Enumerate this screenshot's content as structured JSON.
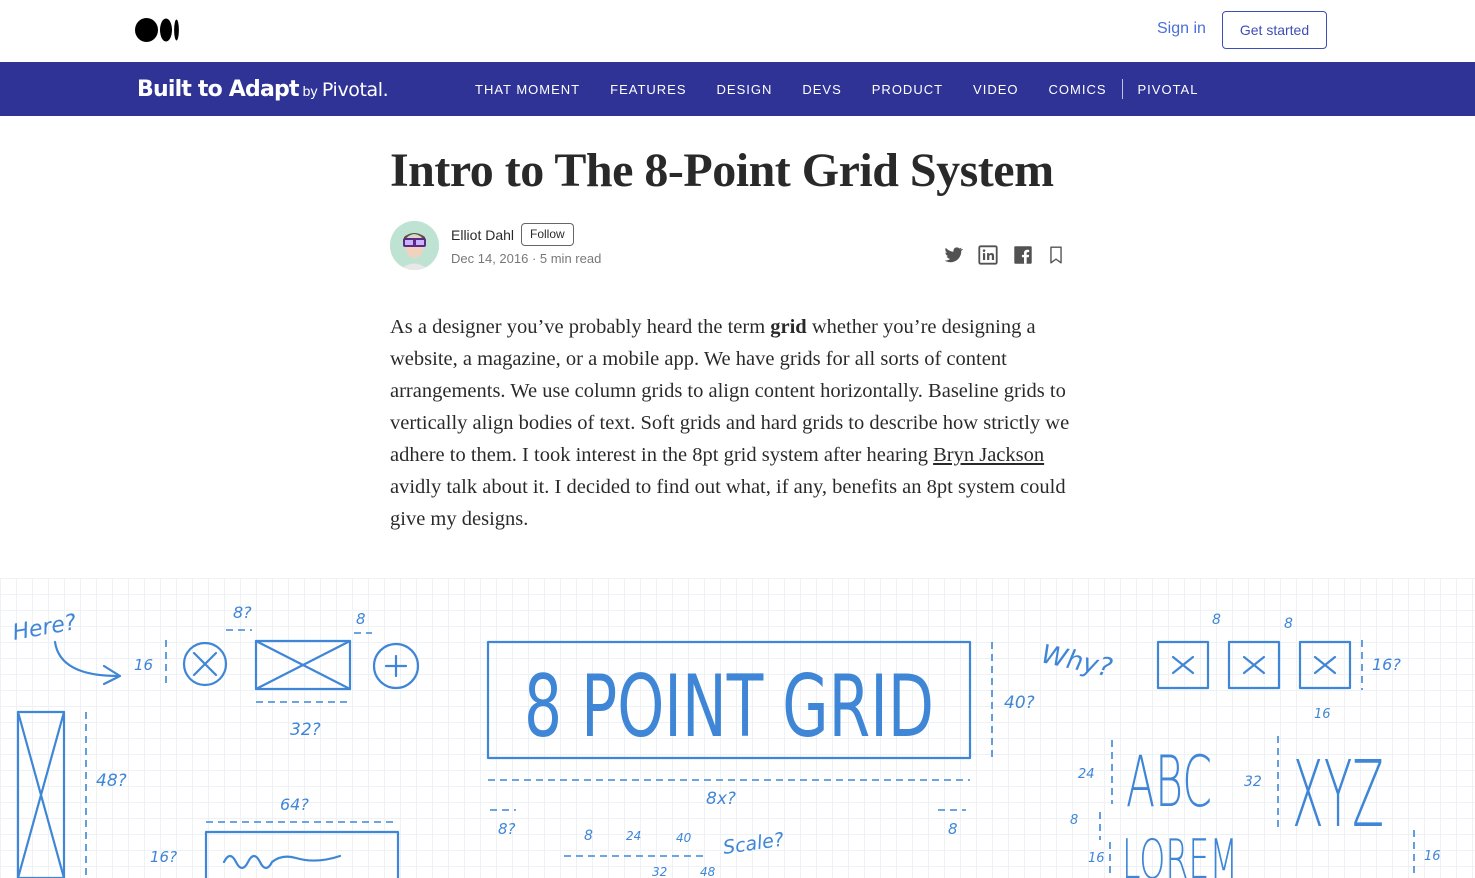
{
  "header": {
    "sign_in": "Sign in",
    "get_started": "Get started"
  },
  "publication": {
    "name_main": "Built to Adapt",
    "name_by": "by",
    "name_brand": "Pivotal.",
    "nav": [
      "THAT MOMENT",
      "FEATURES",
      "DESIGN",
      "DEVS",
      "PRODUCT",
      "VIDEO",
      "COMICS",
      "PIVOTAL"
    ]
  },
  "article": {
    "title": "Intro to The 8-Point Grid System",
    "author": "Elliot Dahl",
    "follow": "Follow",
    "meta": "Dec 14, 2016 · 5 min read",
    "p_before_bold": "As a designer you’ve probably heard the term ",
    "p_bold": "grid",
    "p_after_bold": " whether you’re designing a website, a magazine, or a mobile app. We have grids for all sorts of content arrangements. We use column grids to align content horizontally. Baseline grids to vertically align bodies of text. Soft grids and hard grids to describe how strictly we adhere to them. I took interest in the 8pt grid system after hearing ",
    "p_link": "Bryn Jackson",
    "p_after_link": " avidly talk about it. I decided to find out what, if any, benefits an 8pt system could give my designs."
  },
  "hero": {
    "headline": "8 POINT GRID",
    "notes": {
      "here": "Here?",
      "why": "Why?",
      "scale": "Scale?",
      "abc": "ABC",
      "xyz": "XYZ",
      "lorem": "LOREM",
      "n8q": "8?",
      "n8": "8",
      "n16": "16",
      "n16q": "16?",
      "n32q": "32?",
      "n48q": "48?",
      "n64q": "64?",
      "n40q": "40?",
      "n8xq": "8x?",
      "n24": "24",
      "n32": "32",
      "n40": "40",
      "n48": "48"
    }
  },
  "colors": {
    "brand_bar": "#2f3396",
    "accent_link": "#4a6fd9",
    "sketch_blue": "#3f86d6"
  }
}
